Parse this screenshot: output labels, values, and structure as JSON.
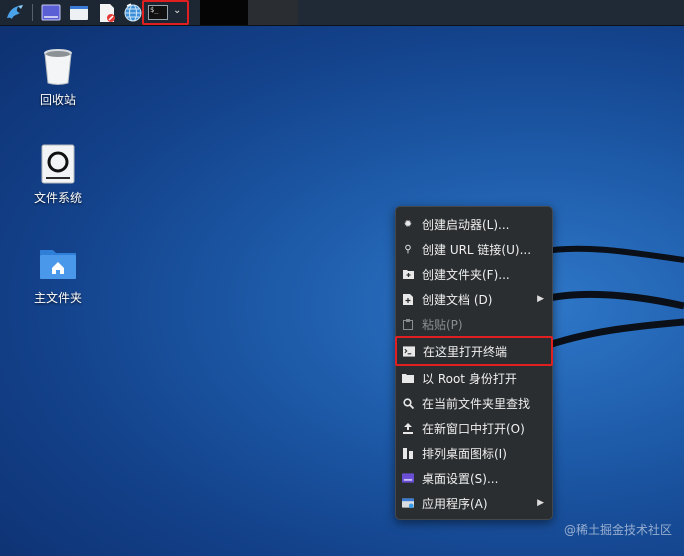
{
  "desktop": {
    "icons": [
      {
        "label": "回收站",
        "icon": "trash-icon"
      },
      {
        "label": "文件系统",
        "icon": "drive-icon"
      },
      {
        "label": "主文件夹",
        "icon": "home-folder-icon"
      }
    ]
  },
  "context_menu": {
    "items": [
      {
        "label": "创建启动器(L)...",
        "icon": "gear-icon"
      },
      {
        "label": "创建 URL 链接(U)...",
        "icon": "link-icon"
      },
      {
        "label": "创建文件夹(F)...",
        "icon": "new-folder-icon"
      },
      {
        "label": "创建文档 (D)",
        "icon": "new-document-icon"
      },
      {
        "label": "粘贴(P)",
        "icon": "paste-icon"
      },
      {
        "label": "在这里打开终端",
        "icon": "terminal-icon"
      },
      {
        "label": "以 Root 身份打开",
        "icon": "folder-icon"
      },
      {
        "label": "在当前文件夹里查找",
        "icon": "search-icon"
      },
      {
        "label": "在新窗口中打开(O)",
        "icon": "upload-icon"
      },
      {
        "label": "排列桌面图标(I)",
        "icon": "arrange-icon"
      },
      {
        "label": "桌面设置(S)...",
        "icon": "desktop-settings-icon"
      },
      {
        "label": "应用程序(A)",
        "icon": "applications-icon"
      }
    ]
  },
  "watermark": "@稀土掘金技术社区",
  "colors": {
    "highlight_border": "#e02020",
    "menu_bg": "#2b2e31"
  }
}
